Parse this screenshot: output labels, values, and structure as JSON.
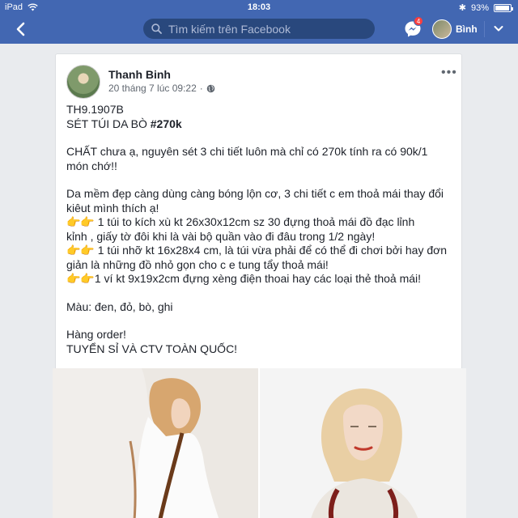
{
  "status": {
    "device": "iPad",
    "time": "18:03",
    "battery": "93%",
    "battery_level": 0.93
  },
  "nav": {
    "back_icon": "chevron-left-icon",
    "search_placeholder": "Tìm kiếm trên Facebook",
    "messenger_badge": "4",
    "user_name": "Bình"
  },
  "post": {
    "author": "Thanh Binh",
    "timestamp": "20 tháng 7 lúc 09:22",
    "audience_icon": "globe-icon",
    "lines": [
      {
        "text": "TH9.1907B"
      },
      {
        "text": "SÉT TÚI DA BÒ ",
        "bold": "#270k"
      },
      {
        "gap": true
      },
      {
        "text": "CHẤT chưa ạ, nguyên sét 3 chi tiết luôn mà chỉ có 270k tính ra có 90k/1"
      },
      {
        "text": "món chớ!!"
      },
      {
        "gap": true
      },
      {
        "text": "Da mềm đẹp càng dùng càng bóng lộn cơ, 3 chi tiết c em thoả mái thay đổi"
      },
      {
        "text": "kiêut mình thích ạ!"
      },
      {
        "text": "👉👉 1 túi to kích xù kt 26x30x12cm sz 30 đựng thoả mái đồ đạc lỉnh"
      },
      {
        "text": "kỉnh , giấy tờ đôi khi là vài bộ quần vào đi đâu trong 1/2 ngày!"
      },
      {
        "text": "👉👉 1 túi nhỡ kt 16x28x4 cm, là túi vừa phải để có thể đi chơi bởi hay đơn"
      },
      {
        "text": "giản là những đồ nhỏ gọn cho c e tung tẩy thoả mái!"
      },
      {
        "text": "👉👉1 ví kt 9x19x2cm đựng xèng điện thoai hay các loại thẻ thoả mái!"
      },
      {
        "gap": true
      },
      {
        "text": "Màu: đen, đỏ, bò, ghi"
      },
      {
        "gap": true
      },
      {
        "text": "Hàng order!"
      },
      {
        "text": "TUYỂN SỈ VÀ CTV TOÀN QUỐC!"
      }
    ]
  }
}
